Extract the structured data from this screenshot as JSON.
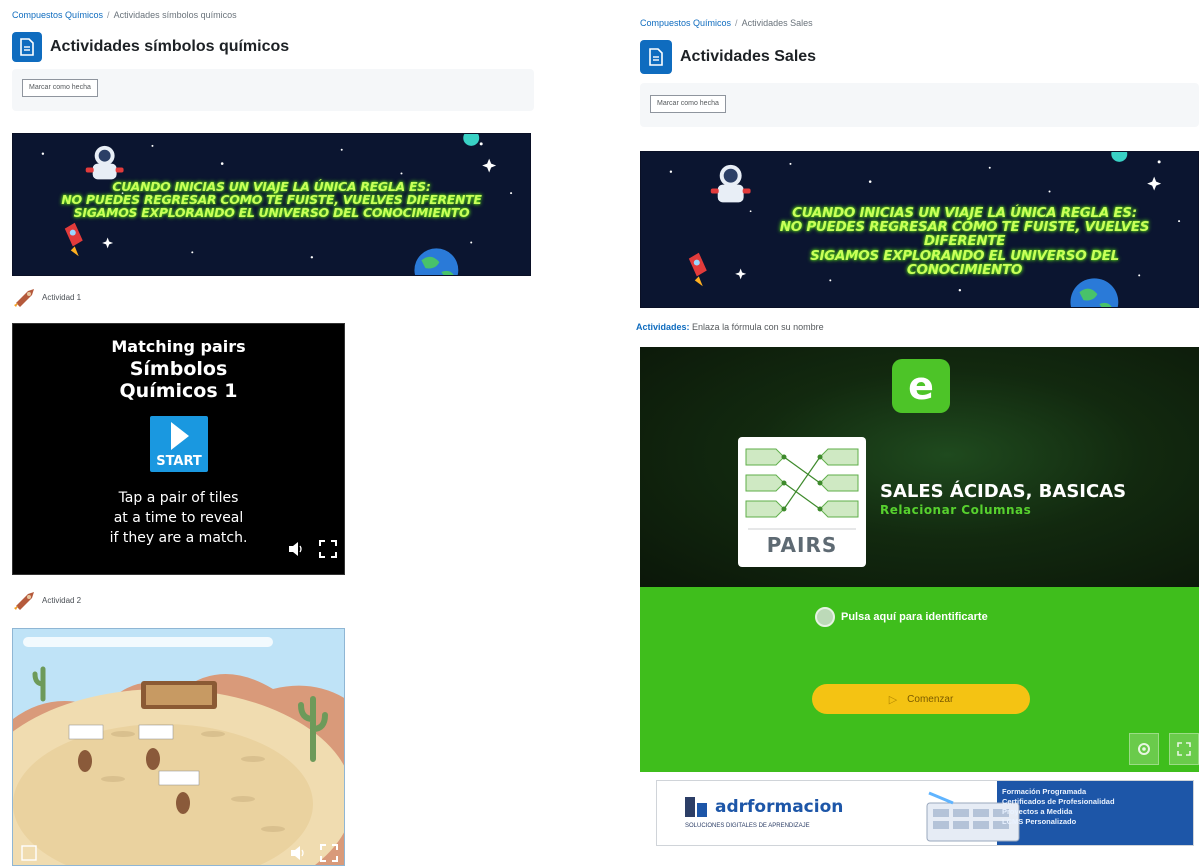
{
  "left": {
    "breadcrumb": {
      "course": "Compuestos Químicos",
      "separator": "/",
      "current": "Actividades símbolos químicos"
    },
    "title": "Actividades símbolos químicos",
    "mark_done_button": "Marcar como hecha",
    "banner_lines": [
      "Cuando inicias un viaje la única regla es:",
      "No puedes regresar como te fuiste, vuelves diferente",
      "Sigamos explorando el universo del conocimiento"
    ],
    "activity_1_label": "Actividad 1",
    "matching_pairs": {
      "title_lines": [
        "Matching pairs",
        "Símbolos",
        "Químicos 1"
      ],
      "start_label": "START",
      "description_lines": [
        "Tap a pair of tiles",
        "at a time to reveal",
        "if they are a match."
      ]
    },
    "activity_2_label": "Actividad 2"
  },
  "right": {
    "breadcrumb": {
      "course": "Compuestos Químicos",
      "separator": "/",
      "current": "Actividades Sales"
    },
    "title": "Actividades Sales",
    "mark_done_button": "Marcar como hecha",
    "banner_lines": [
      "Cuando inicias un viaje la única regla es:",
      "No puedes regresar como te fuiste, vuelves diferente",
      "Sigamos explorando el universo del conocimiento"
    ],
    "instruction": {
      "prefix": "Actividades:",
      "text": "Enlaza la fórmula con su nombre"
    },
    "exelearning": {
      "logo_letter": "e",
      "card_label": "PAIRS",
      "heading": "SALES ÁCIDAS, BASICAS",
      "subheading": "Relacionar Columnas",
      "identify_label": "Pulsa aquí para identificarte",
      "start_label": "Comenzar"
    },
    "ad": {
      "brand": "adrformacion",
      "tagline": "SOLUCIONES DIGITALES DE APRENDIZAJE",
      "items": [
        "Formación Programada",
        "Certificados de Profesionalidad",
        "Proyectos a Medida",
        "LCMS Personalizado"
      ]
    }
  },
  "colors": {
    "link_blue": "#0f6cbf",
    "banner_text_green": "#c9ff5a",
    "exe_green": "#3fbe1c",
    "start_yellow": "#f4c313",
    "ad_blue": "#1d56a8"
  }
}
